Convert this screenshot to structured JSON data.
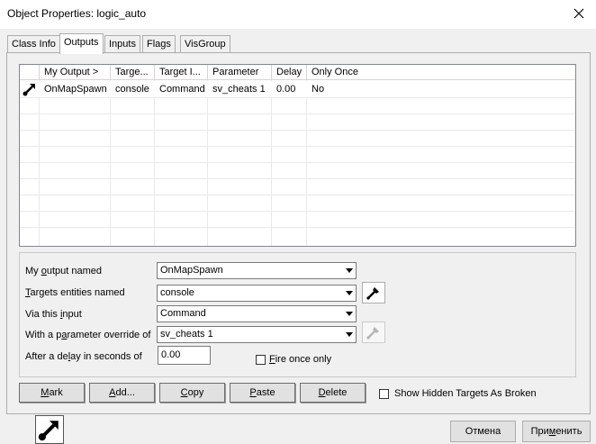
{
  "window": {
    "title": "Object Properties: logic_auto"
  },
  "tabs": [
    "Class Info",
    "Outputs",
    "Inputs",
    "Flags",
    "VisGroup"
  ],
  "grid": {
    "columns": [
      "My Output  >",
      "Targe...",
      "Target I...",
      "Parameter",
      "Delay",
      "Only Once"
    ],
    "rows": [
      {
        "output": "OnMapSpawn",
        "target": "console",
        "input": "Command",
        "parameter": "sv_cheats 1",
        "delay": "0.00",
        "once": "No"
      }
    ]
  },
  "form": {
    "output_named": {
      "label_pre": "My ",
      "label_u": "o",
      "label_post": "utput named",
      "value": "OnMapSpawn"
    },
    "targets": {
      "label_pre": "",
      "label_u": "T",
      "label_post": "argets entities named",
      "value": "console"
    },
    "via_input": {
      "label_pre": "Via this ",
      "label_u": "i",
      "label_post": "nput",
      "value": "Command"
    },
    "param_override": {
      "label_pre": "With a p",
      "label_u": "a",
      "label_post": "rameter override of",
      "value": "sv_cheats 1"
    },
    "delay": {
      "label_pre": "After a de",
      "label_u": "l",
      "label_post": "ay in seconds of",
      "value": "0.00"
    },
    "fire_once": {
      "label_pre": "",
      "label_u": "F",
      "label_post": "ire once only"
    }
  },
  "buttons": {
    "mark": {
      "pre": "",
      "u": "M",
      "post": "ark"
    },
    "add": {
      "pre": "",
      "u": "A",
      "post": "dd..."
    },
    "copy": {
      "pre": "",
      "u": "C",
      "post": "opy"
    },
    "paste": {
      "pre": "",
      "u": "P",
      "post": "aste"
    },
    "delete": {
      "pre": "",
      "u": "D",
      "post": "elete"
    }
  },
  "show_hidden": {
    "label": "Show Hidden Targets As Broken"
  },
  "footer": {
    "cancel": "Отмена",
    "apply_pre": "При",
    "apply_u": "м",
    "apply_post": "енить"
  },
  "icons": {
    "output": "output-arrow-icon",
    "dropper": "eyedropper-icon",
    "close": "close-icon"
  }
}
